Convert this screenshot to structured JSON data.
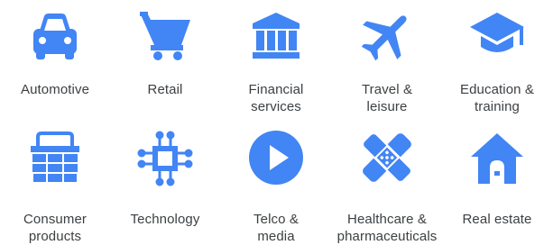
{
  "accent_color": "#4285f4",
  "industries": [
    {
      "icon": "car-icon",
      "label_lines": [
        "Automotive"
      ]
    },
    {
      "icon": "shopping-cart-icon",
      "label_lines": [
        "Retail"
      ]
    },
    {
      "icon": "bank-icon",
      "label_lines": [
        "Financial",
        "services"
      ]
    },
    {
      "icon": "airplane-icon",
      "label_lines": [
        "Travel &",
        "leisure"
      ]
    },
    {
      "icon": "graduation-cap-icon",
      "label_lines": [
        "Education &",
        "training"
      ]
    },
    {
      "icon": "basket-icon",
      "label_lines": [
        "Consumer",
        "products"
      ]
    },
    {
      "icon": "chip-icon",
      "label_lines": [
        "Technology"
      ]
    },
    {
      "icon": "play-icon",
      "label_lines": [
        "Telco &",
        "media"
      ]
    },
    {
      "icon": "bandage-icon",
      "label_lines": [
        "Healthcare &",
        "pharmaceuticals"
      ]
    },
    {
      "icon": "house-icon",
      "label_lines": [
        "Real estate"
      ]
    }
  ]
}
